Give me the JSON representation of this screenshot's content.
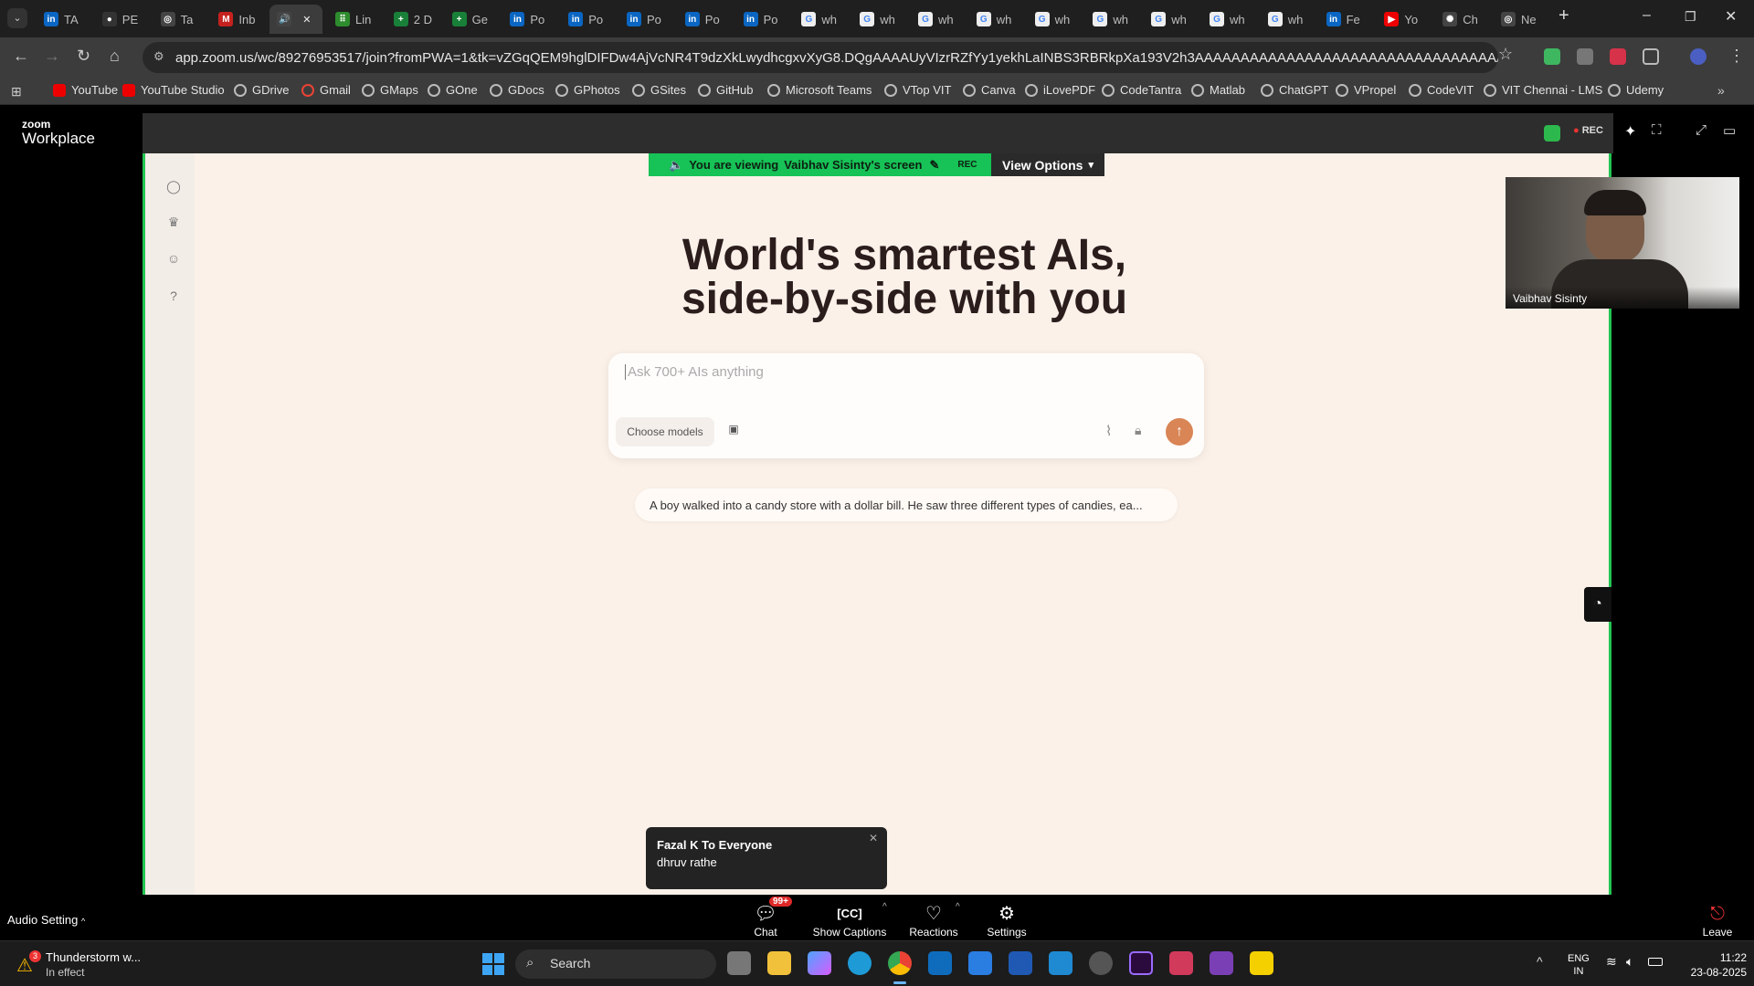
{
  "browser": {
    "tabs": [
      {
        "label": "TA",
        "color": "#0a66c2",
        "glyph": "in"
      },
      {
        "label": "PE",
        "color": "#333",
        "glyph": "●"
      },
      {
        "label": "Ta",
        "color": "#444",
        "glyph": "◎"
      },
      {
        "label": "Inb",
        "color": "#c5221f",
        "glyph": "M"
      },
      {
        "label": "",
        "color": "#444",
        "glyph": "🔊",
        "active": true
      },
      {
        "label": "Lin",
        "color": "#2d8c2d",
        "glyph": "⠿"
      },
      {
        "label": "2 D",
        "color": "#188038",
        "glyph": "+"
      },
      {
        "label": "Ge",
        "color": "#188038",
        "glyph": "+"
      },
      {
        "label": "Po",
        "color": "#0a66c2",
        "glyph": "in"
      },
      {
        "label": "Po",
        "color": "#0a66c2",
        "glyph": "in"
      },
      {
        "label": "Po",
        "color": "#0a66c2",
        "glyph": "in"
      },
      {
        "label": "Po",
        "color": "#0a66c2",
        "glyph": "in"
      },
      {
        "label": "Po",
        "color": "#0a66c2",
        "glyph": "in"
      },
      {
        "label": "wh",
        "color": "#eee",
        "glyph": "G"
      },
      {
        "label": "wh",
        "color": "#eee",
        "glyph": "G"
      },
      {
        "label": "wh",
        "color": "#eee",
        "glyph": "G"
      },
      {
        "label": "wh",
        "color": "#eee",
        "glyph": "G"
      },
      {
        "label": "wh",
        "color": "#eee",
        "glyph": "G"
      },
      {
        "label": "wh",
        "color": "#eee",
        "glyph": "G"
      },
      {
        "label": "wh",
        "color": "#eee",
        "glyph": "G"
      },
      {
        "label": "wh",
        "color": "#eee",
        "glyph": "G"
      },
      {
        "label": "wh",
        "color": "#eee",
        "glyph": "G"
      },
      {
        "label": "Fe",
        "color": "#0a66c2",
        "glyph": "in"
      },
      {
        "label": "Yo",
        "color": "#e00",
        "glyph": "▶"
      },
      {
        "label": "Ch",
        "color": "#444",
        "glyph": "✺"
      },
      {
        "label": "Ne",
        "color": "#444",
        "glyph": "◎"
      }
    ],
    "url": "app.zoom.us/wc/89276953517/join?fromPWA=1&tk=vZGqQEM9hglDIFDw4AjVcNR4T9dzXkLwydhcgxvXyG8.DQgAAAAUyVIzrRZfYy1yekhLaINBS3RBRkpXa193V2h3AAAAAAAAAAAAAAAAAAAAAAAAAAAAAAAAAAAAAAA&_x_zm_r...",
    "bookmarks": [
      "YouTube",
      "YouTube Studio",
      "GDrive",
      "Gmail",
      "GMaps",
      "GOne",
      "GDocs",
      "GPhotos",
      "GSites",
      "GitHub",
      "Microsoft Teams",
      "VTop VIT",
      "Canva",
      "iLovePDF",
      "CodeTantra",
      "Matlab",
      "ChatGPT",
      "VPropel",
      "CodeVIT",
      "VIT Chennai - LMS",
      "Udemy"
    ]
  },
  "zoom": {
    "logo_small": "zoom",
    "logo_big": "Workplace",
    "rec_label": "REC",
    "banner": {
      "prefix": "You are viewing",
      "name": "Vaibhav Sisinty's screen",
      "rec": "REC"
    },
    "view_options": "View Options",
    "participant": "Vaibhav Sisinty",
    "shared": {
      "headline1": "World's smartest AIs,",
      "headline2": "side-by-side with you",
      "placeholder": "Ask 700+ AIs anything",
      "choose_models": "Choose models",
      "suggestion": "A boy walked into a candy store with a dollar bill. He saw three different types of candies, ea..."
    },
    "chat_notification": {
      "from": "Fazal K To Everyone",
      "message": "dhruv rathe"
    },
    "audio_setting": "Audio Setting",
    "toolbar": {
      "chat": "Chat",
      "chat_badge": "99+",
      "captions": "Show Captions",
      "reactions": "Reactions",
      "settings": "Settings",
      "leave": "Leave"
    }
  },
  "taskbar": {
    "weather_title": "Thunderstorm w...",
    "weather_sub": "In effect",
    "weather_badge": "3",
    "search": "Search",
    "lang1": "ENG",
    "lang2": "IN",
    "time": "11:22",
    "date": "23-08-2025"
  }
}
